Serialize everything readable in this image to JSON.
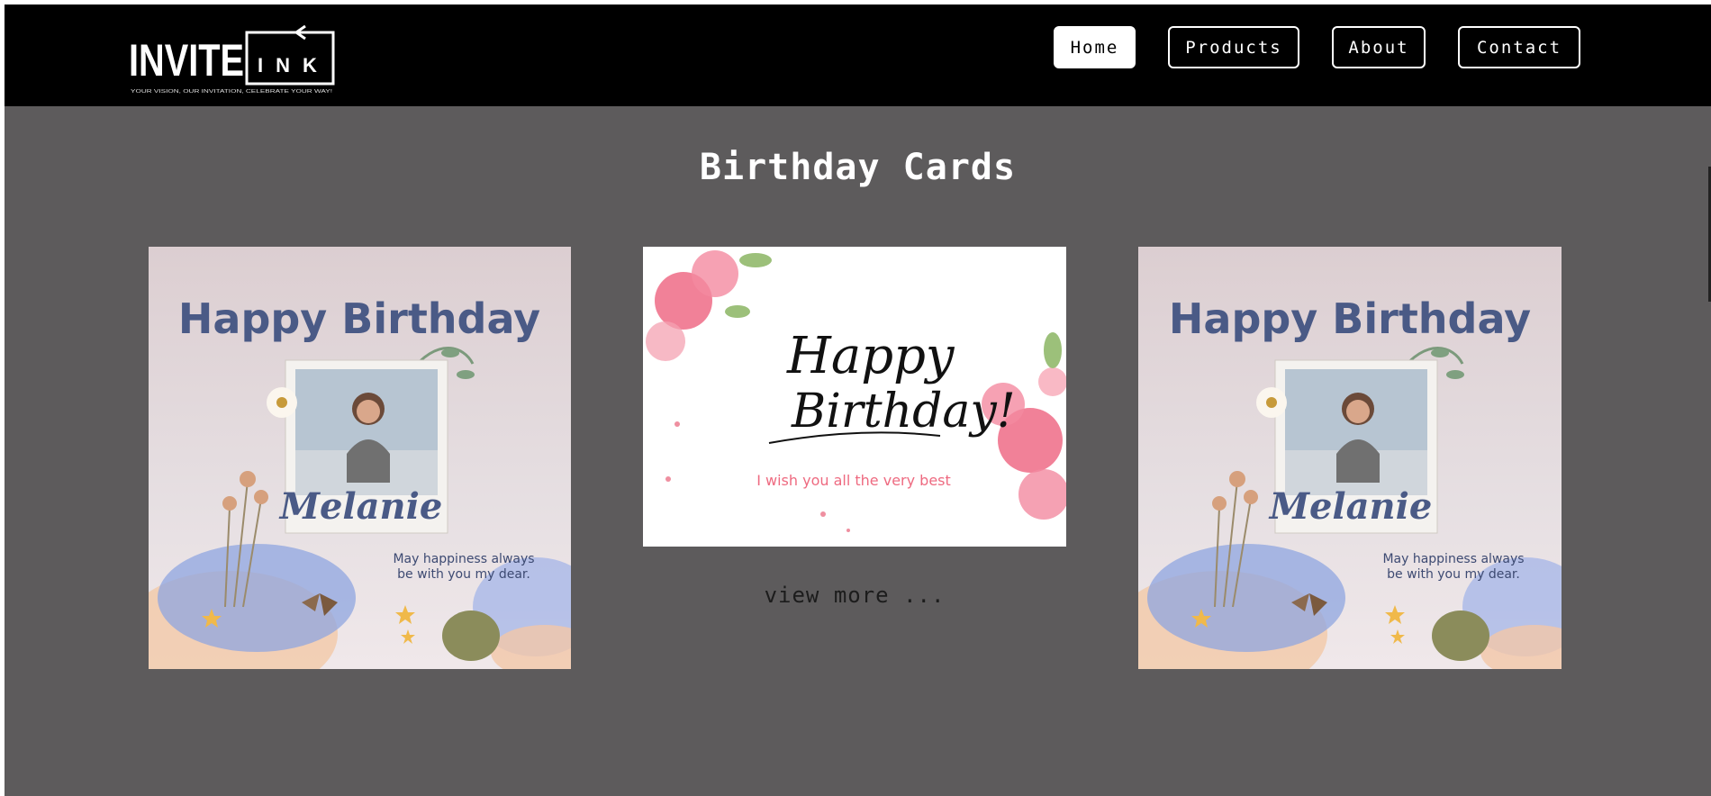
{
  "brand": {
    "logo_main": "INVITE",
    "logo_accent": "INK",
    "tagline": "YOUR VISION, OUR INVITATION, CELEBRATE YOUR WAY!"
  },
  "nav": {
    "home": "Home",
    "products": "Products",
    "about": "About",
    "contact": "Contact"
  },
  "page": {
    "title": "Birthday Cards",
    "view_more": "view more ..."
  },
  "cards": [
    {
      "heading": "Happy Birthday",
      "name": "Melanie",
      "message_line1": "May happiness always",
      "message_line2": "be with you my dear."
    },
    {
      "heading_line1": "Happy",
      "heading_line2": "Birthday!",
      "message": "I wish you all the very best"
    },
    {
      "heading": "Happy Birthday",
      "name": "Melanie",
      "message_line1": "May happiness always",
      "message_line2": "be with you my dear."
    }
  ],
  "colors": {
    "navbar": "#000000",
    "content_bg": "#5d5b5c",
    "card_heading": "#4a5a86",
    "floral_pink": "#ef6b86",
    "message_pink": "#ee6a80"
  }
}
